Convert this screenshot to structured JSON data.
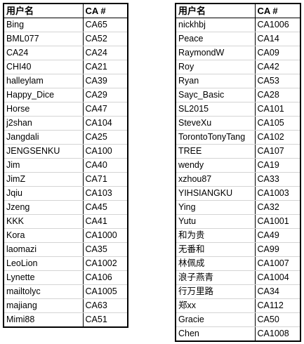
{
  "headers": {
    "username": "用户名",
    "ca": "CA #"
  },
  "left_table": [
    {
      "user": "Bing",
      "ca": "CA65"
    },
    {
      "user": "BML077",
      "ca": "CA52"
    },
    {
      "user": "CA24",
      "ca": "CA24"
    },
    {
      "user": "CHI40",
      "ca": "CA21"
    },
    {
      "user": "halleylam",
      "ca": "CA39"
    },
    {
      "user": "Happy_Dice",
      "ca": "CA29"
    },
    {
      "user": "Horse",
      "ca": "CA47"
    },
    {
      "user": "j2shan",
      "ca": "CA104"
    },
    {
      "user": "Jangdali",
      "ca": "CA25"
    },
    {
      "user": "JENGSENKU",
      "ca": "CA100"
    },
    {
      "user": "Jim",
      "ca": "CA40"
    },
    {
      "user": "JimZ",
      "ca": "CA71"
    },
    {
      "user": "Jqiu",
      "ca": "CA103"
    },
    {
      "user": "Jzeng",
      "ca": "CA45"
    },
    {
      "user": "KKK",
      "ca": "CA41"
    },
    {
      "user": "Kora",
      "ca": "CA1000"
    },
    {
      "user": "laomazi",
      "ca": "CA35"
    },
    {
      "user": "LeoLion",
      "ca": "CA1002"
    },
    {
      "user": "Lynette",
      "ca": "CA106"
    },
    {
      "user": "mailtolyc",
      "ca": "CA1005"
    },
    {
      "user": "majiang",
      "ca": "CA63"
    },
    {
      "user": "Mimi88",
      "ca": "CA51"
    }
  ],
  "right_table": [
    {
      "user": "nickhbj",
      "ca": "CA1006"
    },
    {
      "user": "Peace",
      "ca": "CA14"
    },
    {
      "user": "RaymondW",
      "ca": "CA09"
    },
    {
      "user": "Roy",
      "ca": "CA42"
    },
    {
      "user": "Ryan",
      "ca": "CA53"
    },
    {
      "user": "Sayc_Basic",
      "ca": "CA28"
    },
    {
      "user": "SL2015",
      "ca": "CA101"
    },
    {
      "user": "SteveXu",
      "ca": "CA105"
    },
    {
      "user": "TorontoTonyTang",
      "ca": "CA102"
    },
    {
      "user": "TREE",
      "ca": "CA107"
    },
    {
      "user": "wendy",
      "ca": "CA19"
    },
    {
      "user": "xzhou87",
      "ca": "CA33"
    },
    {
      "user": "YIHSIANGKU",
      "ca": "CA1003"
    },
    {
      "user": "Ying",
      "ca": "CA32"
    },
    {
      "user": "Yutu",
      "ca": "CA1001"
    },
    {
      "user": "和为贵",
      "ca": "CA49"
    },
    {
      "user": "无番和",
      "ca": "CA99"
    },
    {
      "user": "林佩成",
      "ca": "CA1007"
    },
    {
      "user": "浪子燕青",
      "ca": "CA1004"
    },
    {
      "user": "行万里路",
      "ca": "CA34"
    },
    {
      "user": "郑xx",
      "ca": "CA112"
    },
    {
      "user": "Gracie",
      "ca": "CA50"
    },
    {
      "user": "Chen",
      "ca": "CA1008"
    }
  ]
}
